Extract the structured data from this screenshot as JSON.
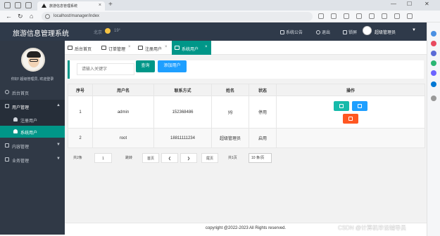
{
  "browser": {
    "tab_title": "旅游信息管理系统",
    "url": "localhost/manager/index",
    "new_tab": "+",
    "back": "←",
    "refresh": "↻",
    "home": "⌂",
    "close_tab": "×",
    "minimize": "—",
    "maximize": "☐",
    "close_window": "✕",
    "side_panel_colors": [
      "#4a90e2",
      "#e84a5f",
      "#5b6bd6",
      "#2bb673",
      "#6c63ff",
      "#0078d4",
      "#999999"
    ]
  },
  "header": {
    "logo": "旅游信息管理系统",
    "city": "北京",
    "temperature": "19°",
    "notice": "系统公告",
    "logout": "退出",
    "lock": "锁屏",
    "username": "超级管理员",
    "caret": "▼"
  },
  "sidebar": {
    "greeting": "你好! 超级管理员, 欢迎登录",
    "items": [
      {
        "label": "后台首页",
        "arrow": ""
      },
      {
        "label": "用户管理",
        "arrow": "▲"
      },
      {
        "label": "内容管理",
        "arrow": "▼"
      },
      {
        "label": "业务管理",
        "arrow": "▼"
      }
    ],
    "sub_items": [
      {
        "label": "注册用户"
      },
      {
        "label": "系统用户"
      }
    ]
  },
  "tabs": [
    {
      "label": "后台首页",
      "close": ""
    },
    {
      "label": "订单管理",
      "close": "×"
    },
    {
      "label": "注册用户",
      "close": "×"
    },
    {
      "label": "系统用户",
      "close": "×"
    }
  ],
  "search": {
    "placeholder": "请输入关键字",
    "query_button": "查询",
    "add_button": "添加用户"
  },
  "table": {
    "headers": [
      "序号",
      "用户名",
      "联系方式",
      "姓名",
      "状态",
      "操作"
    ],
    "rows": [
      {
        "no": "1",
        "username": "admin",
        "contact": "152368486",
        "name": "yg",
        "status": "停用"
      },
      {
        "no": "2",
        "username": "root",
        "contact": "18811111234",
        "name": "超级管理员",
        "status": "启用"
      }
    ]
  },
  "pagination": {
    "total": "共2条",
    "current": "1",
    "jump": "跳转",
    "first": "首页",
    "prev": "❮",
    "next": "❯",
    "last": "尾页",
    "pages": "共1页",
    "page_size": "10 条/页"
  },
  "footer": {
    "copyright": "copyright @2022-2023 All Rights reserved."
  },
  "watermark": "CSDN @计算机毕设辅导员",
  "colors": {
    "accent": "#009688",
    "blue": "#1e9fff",
    "danger": "#ff5722",
    "header_bg": "#2f3a4a",
    "sidebar_bg": "#303946"
  }
}
